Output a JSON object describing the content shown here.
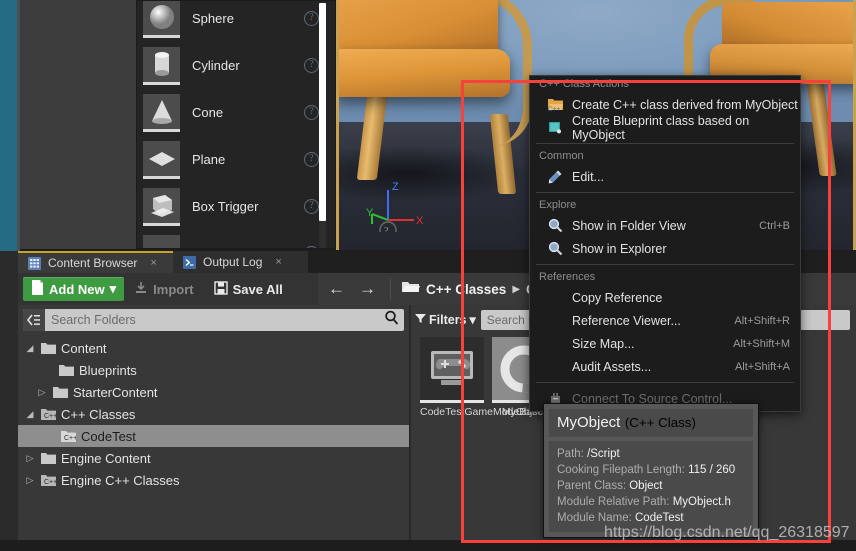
{
  "viewport": {
    "gizmo": {
      "x_label": "X",
      "y_label": "Y",
      "z_label": "Z",
      "x_color": "#e03030",
      "y_color": "#2fc02f",
      "z_color": "#3b6ef0"
    },
    "help_icon": "question-mark-icon"
  },
  "place_actors": {
    "items": [
      {
        "label": "Sphere",
        "icon": "sphere-thumbnail"
      },
      {
        "label": "Cylinder",
        "icon": "cylinder-thumbnail"
      },
      {
        "label": "Cone",
        "icon": "cone-thumbnail"
      },
      {
        "label": "Plane",
        "icon": "plane-thumbnail"
      },
      {
        "label": "Box Trigger",
        "icon": "box-trigger-thumbnail"
      },
      {
        "label": "",
        "icon": "sphere-trigger-thumbnail"
      }
    ]
  },
  "dock": {
    "tabs": [
      {
        "label": "Content Browser",
        "icon": "content-browser-icon",
        "active": true,
        "close": "×"
      },
      {
        "label": "Output Log",
        "icon": "output-log-icon",
        "active": false,
        "close": "×"
      }
    ]
  },
  "toolbar": {
    "add_new_label": "Add New",
    "add_new_caret": "▾",
    "import_label": "Import",
    "save_all_label": "Save All",
    "back_arrow": "←",
    "forward_arrow": "→",
    "breadcrumbs": [
      {
        "label": "C++ Classes"
      },
      {
        "label": "C"
      }
    ],
    "crumb_sep": "▶"
  },
  "folders": {
    "search_placeholder": "Search Folders",
    "tree": [
      {
        "label": "Content",
        "depth": 0,
        "twisty": "◢",
        "icon": "folder-icon",
        "selected": false
      },
      {
        "label": "Blueprints",
        "depth": 1,
        "twisty": "",
        "icon": "folder-icon",
        "selected": false
      },
      {
        "label": "StarterContent",
        "depth": 1,
        "twisty": "▷",
        "icon": "folder-icon",
        "selected": false
      },
      {
        "label": "C++ Classes",
        "depth": 0,
        "twisty": "◢",
        "icon": "cpp-folder-icon",
        "selected": false
      },
      {
        "label": "CodeTest",
        "depth": 1,
        "twisty": "",
        "icon": "cpp-folder-icon",
        "selected": true
      },
      {
        "label": "Engine Content",
        "depth": 0,
        "twisty": "▷",
        "icon": "folder-icon",
        "selected": false
      },
      {
        "label": "Engine C++ Classes",
        "depth": 0,
        "twisty": "▷",
        "icon": "cpp-folder-icon",
        "selected": false
      }
    ]
  },
  "assets": {
    "filters_label": "Filters",
    "filters_caret": "▾",
    "search_placeholder": "Search C",
    "tiles": [
      {
        "name": "CodeTestGameModeBase",
        "icon": "gamepad-thumbnail",
        "selected": false
      },
      {
        "name": "MyObject",
        "icon": "uobject-thumbnail",
        "selected": true
      }
    ]
  },
  "context_menu": {
    "sections": [
      {
        "header": "C++ Class Actions",
        "items": [
          {
            "label": "Create C++ class derived from MyObject",
            "shortcut": "",
            "icon": "cpp-class-icon",
            "disabled": false
          },
          {
            "label": "Create Blueprint class based on MyObject",
            "shortcut": "",
            "icon": "blueprint-class-icon",
            "disabled": false
          }
        ]
      },
      {
        "header": "Common",
        "items": [
          {
            "label": "Edit...",
            "shortcut": "",
            "icon": "edit-wrench-icon",
            "disabled": false
          }
        ]
      },
      {
        "header": "Explore",
        "items": [
          {
            "label": "Show in Folder View",
            "shortcut": "Ctrl+B",
            "icon": "magnifier-icon",
            "disabled": false
          },
          {
            "label": "Show in Explorer",
            "shortcut": "",
            "icon": "magnifier-icon",
            "disabled": false
          }
        ]
      },
      {
        "header": "References",
        "items": [
          {
            "label": "Copy Reference",
            "shortcut": "",
            "icon": "",
            "disabled": false
          },
          {
            "label": "Reference Viewer...",
            "shortcut": "Alt+Shift+R",
            "icon": "",
            "disabled": false
          },
          {
            "label": "Size Map...",
            "shortcut": "Alt+Shift+M",
            "icon": "",
            "disabled": false
          },
          {
            "label": "Audit Assets...",
            "shortcut": "Alt+Shift+A",
            "icon": "",
            "disabled": false
          }
        ]
      },
      {
        "header": "",
        "items": [
          {
            "label": "Connect To Source Control...",
            "shortcut": "",
            "icon": "source-control-icon",
            "disabled": true
          }
        ]
      }
    ]
  },
  "tooltip": {
    "title": "MyObject",
    "subtitle": "(C++ Class)",
    "rows": [
      {
        "key": "Path:",
        "value": "/Script"
      },
      {
        "key": "Cooking Filepath Length:",
        "value": "115 / 260"
      },
      {
        "key": "Parent Class:",
        "value": "Object"
      },
      {
        "key": "Module Relative Path:",
        "value": "MyObject.h"
      },
      {
        "key": "Module Name:",
        "value": "CodeTest"
      }
    ]
  },
  "annotation": {
    "watermark": "https://blog.csdn.net/qq_26318597",
    "rect_color": "#f7413a"
  }
}
